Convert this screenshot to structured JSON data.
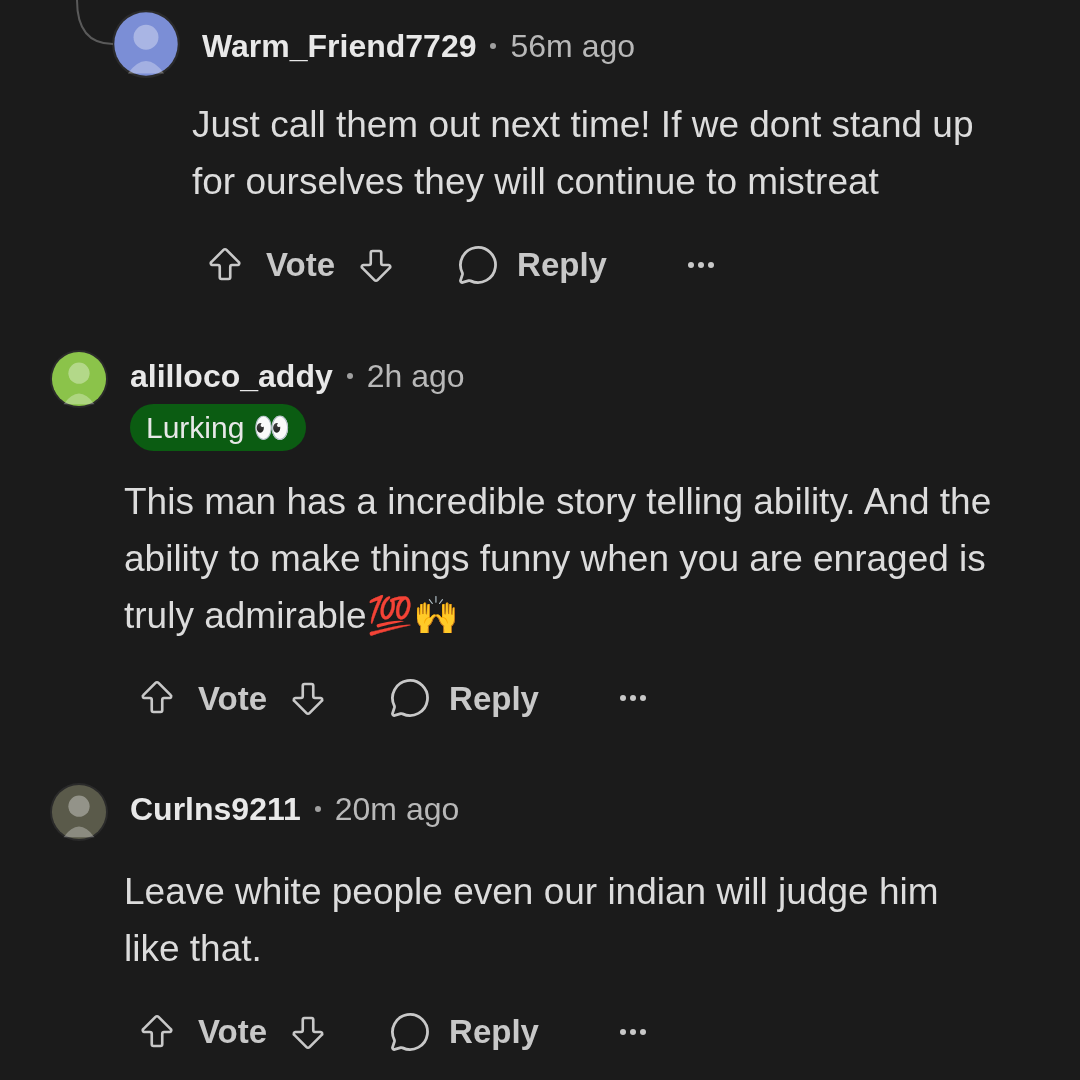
{
  "comments": [
    {
      "kind": "reply",
      "author": "Warm_Friend7729",
      "time": "56m ago",
      "body": "Just call them out next time! If we dont stand up for ourselves they will continue to mistreat",
      "actions": {
        "vote": "Vote",
        "reply": "Reply"
      }
    },
    {
      "kind": "top",
      "author": "alilloco_addy",
      "time": "2h ago",
      "flair": "Lurking 👀",
      "body": "This man has a incredible story telling ability. And the ability to make things funny when you are enraged is truly admirable💯🙌",
      "actions": {
        "vote": "Vote",
        "reply": "Reply"
      }
    },
    {
      "kind": "top",
      "author": "Curlns9211",
      "time": "20m ago",
      "body": "Leave white people even our indian will judge him like that.",
      "actions": {
        "vote": "Vote",
        "reply": "Reply"
      }
    }
  ]
}
